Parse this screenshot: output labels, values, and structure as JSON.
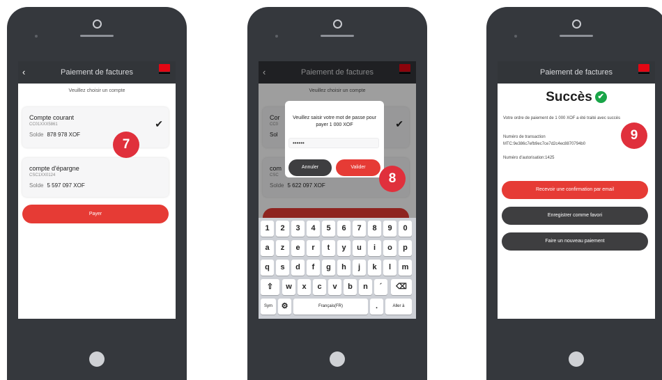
{
  "colors": {
    "accent": "#e63b35",
    "dark": "#3e3e40",
    "success": "#19a548",
    "bg_dark": "#35383d"
  },
  "common": {
    "title": "Paiement de factures",
    "subtitle": "Veuillez choisir un compte"
  },
  "screen1": {
    "accounts": [
      {
        "name": "Compte courant",
        "number": "CC01XXX5861",
        "balance_label": "Solde",
        "balance": "878 978 XOF",
        "selected": true
      },
      {
        "name": "compte d'épargne",
        "number": "CSC1XX0124",
        "balance_label": "Solde",
        "balance": "5 597 097 XOF",
        "selected": false
      }
    ],
    "pay_button": "Payer",
    "badge": "7"
  },
  "screen2": {
    "bg_accounts": [
      {
        "name_partial": "Cor",
        "number_partial": "CC0",
        "balance_partial": "Sol"
      },
      {
        "name_partial": "com",
        "number_partial": "CSC",
        "balance_label": "Solde",
        "balance": "5 622 097 XOF"
      }
    ],
    "dialog": {
      "message": "Veuillez saisir votre mot de passe pour payer 1 000 XOF",
      "password": "••••••",
      "cancel": "Annuler",
      "confirm": "Valider"
    },
    "keyboard": {
      "row1": [
        "1",
        "2",
        "3",
        "4",
        "5",
        "6",
        "7",
        "8",
        "9",
        "0"
      ],
      "row2": [
        "a",
        "z",
        "e",
        "r",
        "t",
        "y",
        "u",
        "i",
        "o",
        "p"
      ],
      "row3": [
        "q",
        "s",
        "d",
        "f",
        "g",
        "h",
        "j",
        "k",
        "l",
        "m"
      ],
      "row4": [
        "⇧",
        "w",
        "x",
        "c",
        "v",
        "b",
        "n",
        "´",
        "⌫"
      ],
      "sym": "Sym",
      "gear": "⚙",
      "space": "Français(FR)",
      "dot": ".",
      "go": "Aller à"
    },
    "badge": "8"
  },
  "screen3": {
    "success_title": "Succès",
    "message": "Votre ordre de paiement de 1 000 XOF a été traité avec succès",
    "txn_label": "Numéro de transaction",
    "txn_value": "MTC:9e386c7efb9ec7ce7d2c4ec8870794b0",
    "auth": "Numéro d'autorisation:1425",
    "email_button": "Recevoir une confirmation par email",
    "favorite_button": "Enregistrer comme favori",
    "new_payment_button": "Faire un nouveau paiement",
    "badge": "9"
  }
}
